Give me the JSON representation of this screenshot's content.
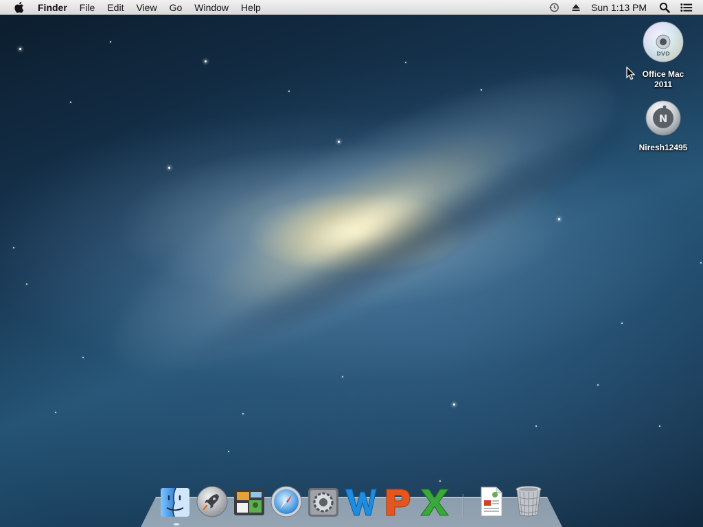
{
  "menubar": {
    "items": [
      {
        "label": "Finder"
      },
      {
        "label": "File"
      },
      {
        "label": "Edit"
      },
      {
        "label": "View"
      },
      {
        "label": "Go"
      },
      {
        "label": "Window"
      },
      {
        "label": "Help"
      }
    ],
    "clock": "Sun 1:13 PM",
    "status_icons": [
      "time-machine-icon",
      "eject-icon",
      "spotlight-search-icon",
      "notification-center-icon"
    ]
  },
  "desktop_icons": [
    {
      "label": "Office Mac 2011",
      "icon": "dvd-disc-icon"
    },
    {
      "label": "Niresh12495",
      "icon": "hard-drive-icon"
    }
  ],
  "dock": {
    "items": [
      "finder-icon",
      "launchpad-icon",
      "photo-browser-icon",
      "safari-icon",
      "system-preferences-icon",
      "word-icon",
      "powerpoint-icon",
      "excel-icon",
      "document-icon",
      "trash-icon"
    ]
  },
  "colors": {
    "menubar_top": "#f2f2f2",
    "menubar_bottom": "#d9d9d9",
    "word_blue": "#1c8de0",
    "powerpoint_orange": "#e4561f",
    "excel_green": "#3aa83a"
  }
}
